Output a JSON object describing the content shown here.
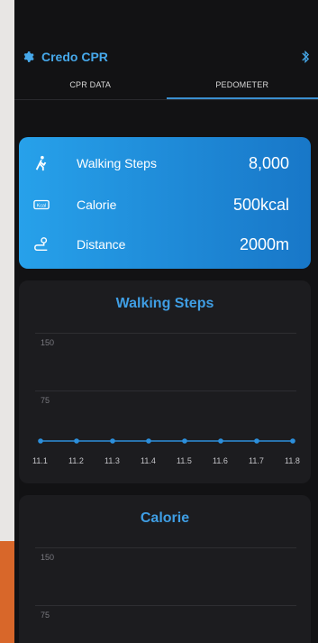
{
  "header": {
    "app_title": "Credo CPR",
    "icons": {
      "left": "gear-icon",
      "right": "bluetooth-icon"
    },
    "accent_color": "#46a8ea"
  },
  "tabs": [
    {
      "label": "CPR DATA",
      "active": false
    },
    {
      "label": "PEDOMETER",
      "active": true
    }
  ],
  "summary": {
    "rows": [
      {
        "icon": "walking-person-icon",
        "label": "Walking Steps",
        "value": "8,000"
      },
      {
        "icon": "kcal-icon",
        "label": "Calorie",
        "value": "500kcal"
      },
      {
        "icon": "distance-icon",
        "label": "Distance",
        "value": "2000m"
      }
    ]
  },
  "cards": {
    "walking": {
      "title": "Walking Steps",
      "y_labels": [
        "150",
        "75"
      ],
      "x_labels": [
        "11.1",
        "11.2",
        "11.3",
        "11.4",
        "11.5",
        "11.6",
        "11.7",
        "11.8"
      ]
    },
    "calorie": {
      "title": "Calorie",
      "y_labels": [
        "150",
        "75"
      ]
    }
  },
  "chart_data": [
    {
      "type": "line",
      "title": "Walking Steps",
      "categories": [
        "11.1",
        "11.2",
        "11.3",
        "11.4",
        "11.5",
        "11.6",
        "11.7",
        "11.8"
      ],
      "series": [
        {
          "values": [
            0,
            0,
            0,
            0,
            0,
            0,
            0,
            0
          ]
        }
      ],
      "y_ticks": [
        75,
        150
      ],
      "ylim": [
        0,
        150
      ]
    },
    {
      "type": "line",
      "title": "Calorie",
      "y_ticks": [
        75,
        150
      ],
      "ylim": [
        0,
        150
      ]
    }
  ]
}
